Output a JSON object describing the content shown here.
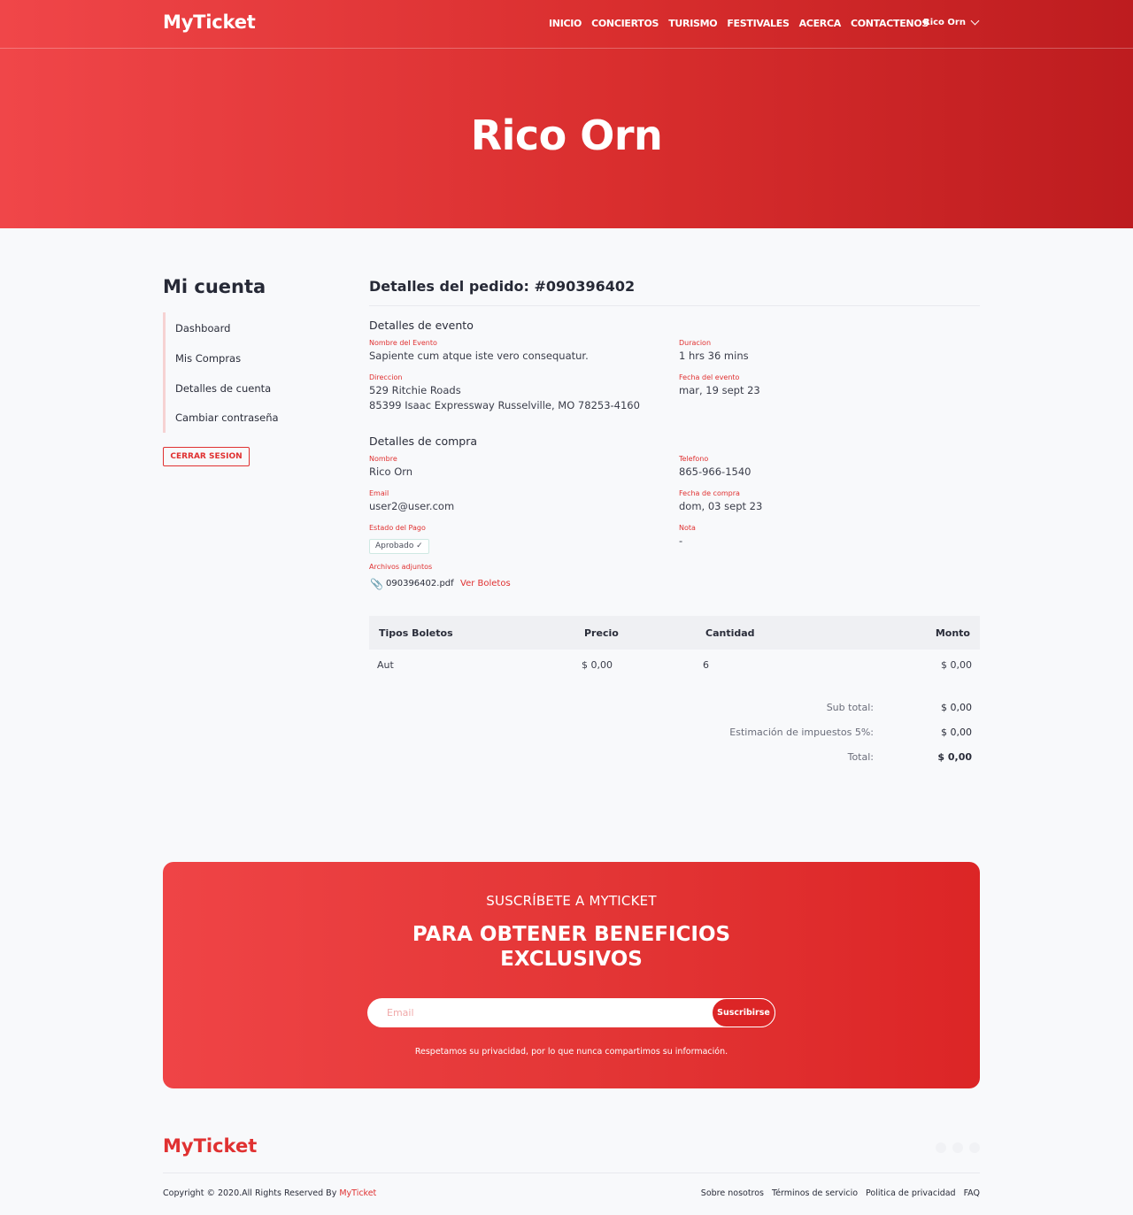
{
  "brand": "MyTicket",
  "nav": {
    "items": [
      "INICIO",
      "CONCIERTOS",
      "TURISMO",
      "FESTIVALES",
      "ACERCA",
      "CONTACTENOS"
    ],
    "user": "Rico Orn"
  },
  "hero": {
    "title": "Rico Orn"
  },
  "sidebar": {
    "title": "Mi cuenta",
    "items": [
      "Dashboard",
      "Mis Compras",
      "Detalles de cuenta",
      "Cambiar contraseña"
    ],
    "logout": "CERRAR SESION"
  },
  "order": {
    "title": "Detalles del pedido: #090396402",
    "event_section": "Detalles de evento",
    "event": {
      "name_label": "Nombre del Evento",
      "name": "Sapiente cum atque iste vero consequatur.",
      "duration_label": "Duracion",
      "duration": "1 hrs 36 mins",
      "address_label": "Direccion",
      "address_line1": "529 Ritchie Roads",
      "address_line2": "85399 Isaac Expressway Russelville, MO 78253-4160",
      "date_label": "Fecha del evento",
      "date": "mar, 19 sept 23"
    },
    "purchase_section": "Detalles de compra",
    "purchase": {
      "name_label": "Nombre",
      "name": "Rico Orn",
      "phone_label": "Telefono",
      "phone": "865-966-1540",
      "email_label": "Email",
      "email": "user2@user.com",
      "purchase_date_label": "Fecha de compra",
      "purchase_date": "dom, 03 sept 23",
      "payment_label": "Estado del Pago",
      "payment_status": "Aprobado ✓",
      "note_label": "Nota",
      "note": "-",
      "attachments_label": "Archivos adjuntos",
      "file_name": "090396402.pdf",
      "view_tickets": "Ver Boletos"
    },
    "table": {
      "headers": [
        "Tipos Boletos",
        "Precio",
        "Cantidad",
        "Monto"
      ],
      "rows": [
        [
          "Aut",
          "$ 0,00",
          "6",
          "$ 0,00"
        ]
      ]
    },
    "totals": {
      "subtotal_label": "Sub total:",
      "subtotal": "$ 0,00",
      "tax_label": "Estimación de impuestos 5%:",
      "tax": "$ 0,00",
      "total_label": "Total:",
      "total": "$ 0,00"
    }
  },
  "subscribe": {
    "eyebrow": "SUSCRÍBETE A MYTICKET",
    "title_line1": "PARA OBTENER BENEFICIOS",
    "title_line2": "EXCLUSIVOS",
    "placeholder": "Email",
    "button": "Suscribirse",
    "note": "Respetamos su privacidad, por lo que nunca compartimos su información."
  },
  "footer": {
    "copyright": "Copyright © 2020.All Rights Reserved By",
    "brand": "MyTicket",
    "links": [
      "Sobre nosotros",
      "Términos de servicio",
      "Politica de privacidad",
      "FAQ"
    ]
  },
  "colors": {
    "accent": "#e03131",
    "hero_start": "#f04649",
    "hero_end": "#bd1c1f"
  }
}
